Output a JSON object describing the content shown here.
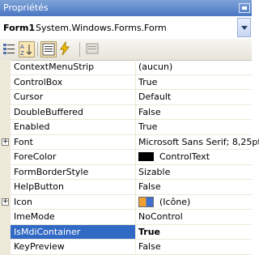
{
  "panel": {
    "title": "Propriétés"
  },
  "object": {
    "name": "Form1",
    "type": "System.Windows.Forms.Form"
  },
  "colors": {
    "forecolor_swatch": "#000000"
  },
  "icons": {
    "toolbar": [
      "categorized-icon",
      "alphabetical-icon",
      "properties-icon",
      "events-icon",
      "property-pages-icon"
    ],
    "pin": "pin-icon"
  },
  "properties": [
    {
      "name": "ContextMenuStrip",
      "value": "(aucun)"
    },
    {
      "name": "ControlBox",
      "value": "True"
    },
    {
      "name": "Cursor",
      "value": "Default"
    },
    {
      "name": "DoubleBuffered",
      "value": "False"
    },
    {
      "name": "Enabled",
      "value": "True"
    },
    {
      "name": "Font",
      "value": "Microsoft Sans Serif; 8,25pt",
      "expandable": true,
      "expander": "+"
    },
    {
      "name": "ForeColor",
      "value": "ControlText"
    },
    {
      "name": "FormBorderStyle",
      "value": "Sizable"
    },
    {
      "name": "HelpButton",
      "value": "False"
    },
    {
      "name": "Icon",
      "value": "(Icône)",
      "expandable": true,
      "expander": "+"
    },
    {
      "name": "ImeMode",
      "value": "NoControl"
    },
    {
      "name": "IsMdiContainer",
      "value": "True",
      "selected": true
    },
    {
      "name": "KeyPreview",
      "value": "False"
    }
  ]
}
